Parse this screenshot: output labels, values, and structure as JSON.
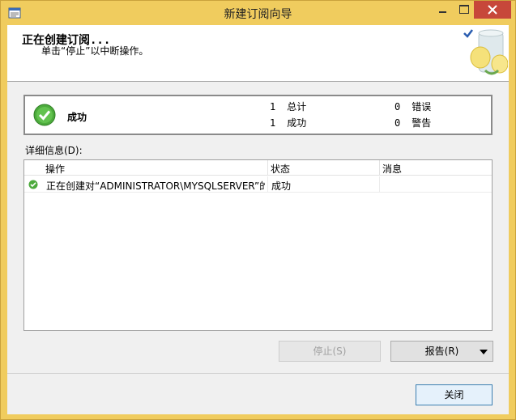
{
  "window": {
    "title": "新建订阅向导",
    "colors": {
      "frame": "#f0cc5e",
      "close_button": "#c7473a"
    }
  },
  "header": {
    "title": "正在创建订阅...",
    "subtitle": "单击“停止”以中断操作。",
    "graphic_icon": "database-check-icon"
  },
  "summary": {
    "status_icon": "success-check-icon",
    "status": "成功",
    "total_count": "1",
    "total_label": "总计",
    "success_count": "1",
    "success_label": "成功",
    "error_count": "0",
    "error_label": "错误",
    "warning_count": "0",
    "warning_label": "警告"
  },
  "details": {
    "label": "详细信息(D):",
    "columns": [
      "操作",
      "状态",
      "消息"
    ],
    "rows": [
      {
        "icon": "success-check-icon",
        "action": "正在创建对“ADMINISTRATOR\\MYSQLSERVER”的...",
        "status": "成功",
        "message": ""
      }
    ]
  },
  "buttons": {
    "stop": "停止(S)",
    "report": "报告(R)",
    "close": "关闭"
  }
}
